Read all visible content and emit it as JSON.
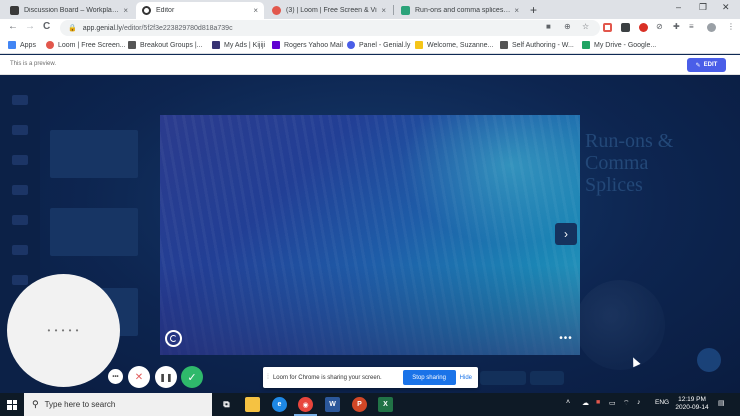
{
  "browser": {
    "tabs": [
      {
        "title": "Discussion Board – Workplace W",
        "active": false,
        "favicon_color": "#3a3a3a"
      },
      {
        "title": "Editor",
        "active": true,
        "favicon_color": "#ffffff"
      },
      {
        "title": "(3) | Loom | Free Screen & Vi",
        "active": false,
        "favicon_color": "#e2574c"
      },
      {
        "title": "Run-ons and comma splices (exc",
        "active": false,
        "favicon_color": "#2ba37a"
      }
    ],
    "close_glyph": "×",
    "new_tab_glyph": "+",
    "window_controls": {
      "minimize": "–",
      "maximize": "❐",
      "close": "✕"
    },
    "address": {
      "host": "app.genial.ly",
      "path": "/editor/5f2f3e223829780d818a739c"
    },
    "nav": {
      "back": "←",
      "forward": "→",
      "reload": "C"
    },
    "bookmarks": [
      {
        "label": "Apps",
        "color": "#4285f4"
      },
      {
        "label": "Loom | Free Screen...",
        "color": "#e2574c"
      },
      {
        "label": "Breakout Groups |...",
        "color": "#555555"
      },
      {
        "label": "My Ads | Kijiji",
        "color": "#373373"
      },
      {
        "label": "Rogers Yahoo Mail",
        "color": "#6001d2"
      },
      {
        "label": "Panel - Genial.ly",
        "color": "#4a5ee8"
      },
      {
        "label": "Welcome, Suzanne...",
        "color": "#f5c518"
      },
      {
        "label": "Self Authoring - W...",
        "color": "#555555"
      },
      {
        "label": "My Drive - Google...",
        "color": "#1fa463"
      }
    ]
  },
  "preview_bar": {
    "message": "This is a preview.",
    "edit_label": "EDIT",
    "edit_icon": "✎"
  },
  "genially": {
    "next_label": "›",
    "more_label": "•••",
    "ghost_title": [
      "Run-ons &",
      "Comma",
      "Splices"
    ]
  },
  "loom": {
    "camera_dots": "• • • • •",
    "menu_label": "•••",
    "cancel_label": "✕",
    "pause_label": "❚❚",
    "done_label": "✓",
    "share_text": "Loom for Chrome is sharing your screen.",
    "stop_label": "Stop sharing",
    "hide_label": "Hide",
    "grip": "⁞"
  },
  "taskbar": {
    "search_placeholder": "Type here to search",
    "search_icon": "⚲",
    "language": "ENG",
    "time": "12:19 PM",
    "date": "2020-09-14",
    "apps": [
      {
        "name": "task-view",
        "color": "#0e1a26",
        "glyph": "⧉"
      },
      {
        "name": "file-explorer",
        "color": "#f5c242",
        "glyph": ""
      },
      {
        "name": "edge",
        "color": "#1e88e5",
        "glyph": "e"
      },
      {
        "name": "chrome",
        "color": "#e8453c",
        "glyph": "◉"
      },
      {
        "name": "word",
        "color": "#2b579a",
        "glyph": "W"
      },
      {
        "name": "powerpoint",
        "color": "#d24726",
        "glyph": "P"
      },
      {
        "name": "excel",
        "color": "#217346",
        "glyph": "X"
      }
    ]
  }
}
